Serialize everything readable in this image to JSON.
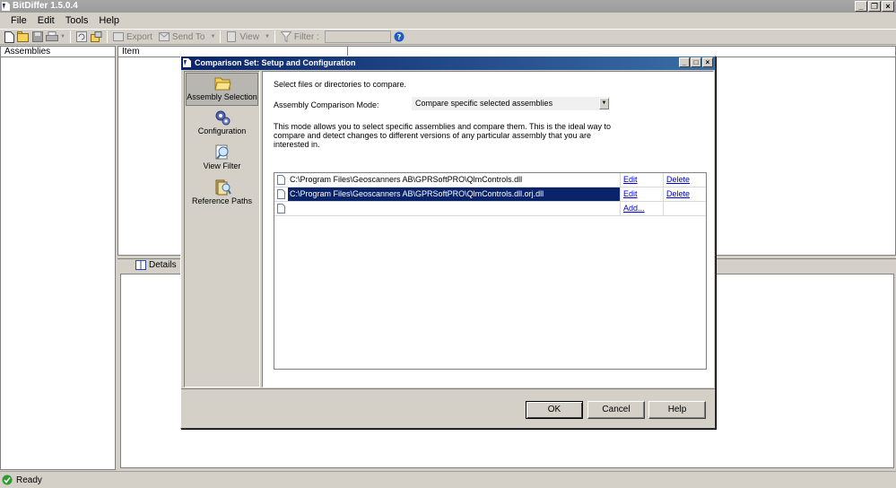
{
  "window": {
    "title": "BitDiffer 1.5.0.4"
  },
  "menu": [
    "File",
    "Edit",
    "Tools",
    "Help"
  ],
  "toolbar": {
    "export_label": "Export",
    "send_to_label": "Send To",
    "view_label": "View",
    "filter_label": "Filter :",
    "filter_value": ""
  },
  "panes": {
    "assemblies_header": "Assemblies",
    "item_header": "Item",
    "details_tab": "Details"
  },
  "status": {
    "text": "Ready"
  },
  "dialog": {
    "title": "Comparison Set: Setup and Configuration",
    "nav": [
      {
        "label": "Assembly Selection",
        "icon": "folder-icon",
        "selected": true
      },
      {
        "label": "Configuration",
        "icon": "gears-icon",
        "selected": false
      },
      {
        "label": "View Filter",
        "icon": "magnifier-icon",
        "selected": false
      },
      {
        "label": "Reference Paths",
        "icon": "reference-paths-icon",
        "selected": false
      }
    ],
    "intro": "Select files or directories to compare.",
    "mode_label": "Assembly Comparison Mode:",
    "mode_value": "Compare specific selected assemblies",
    "description": "This mode allows you to select specific assemblies and compare them. This is the ideal way to compare and detect changes to different versions of any particular assembly that you are interested in.",
    "rows": [
      {
        "path": "C:\\Program Files\\Geoscanners AB\\GPRSoftPRO\\QlmControls.dll",
        "edit": "Edit",
        "delete": "Delete",
        "selected": false
      },
      {
        "path": "C:\\Program Files\\Geoscanners AB\\GPRSoftPRO\\QlmControls.dll.orj.dll",
        "edit": "Edit",
        "delete": "Delete",
        "selected": true
      }
    ],
    "add_label": "Add...",
    "ok": "OK",
    "cancel": "Cancel",
    "help": "Help"
  },
  "colors": {
    "selection": "#0a246a",
    "link": "#0000cc",
    "chrome": "#d4d0c8"
  }
}
